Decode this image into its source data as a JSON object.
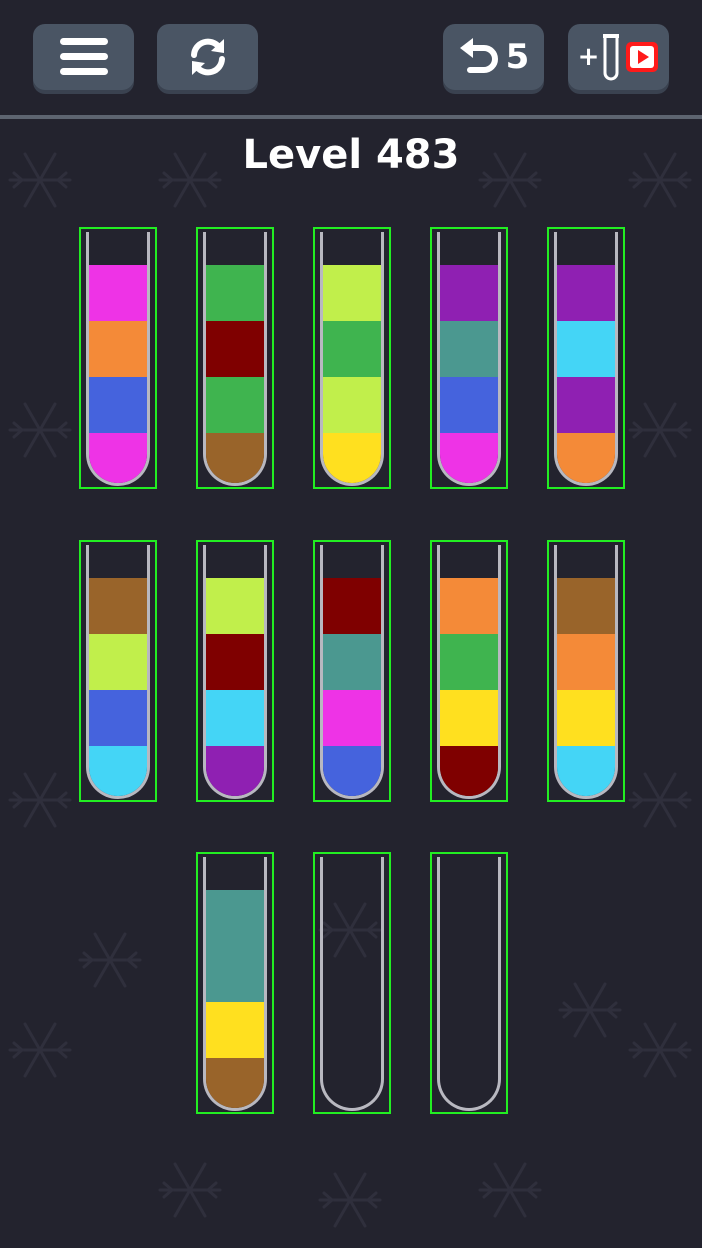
{
  "header": {
    "menu_icon": "hamburger-menu-icon",
    "restart_icon": "refresh-icon",
    "undo_icon": "undo-arrow-icon",
    "undo_count": "5",
    "add_tube_label": "+",
    "add_tube_icons": [
      "test-tube-icon",
      "video-ad-icon"
    ]
  },
  "level_title": "Level 483",
  "colors": {
    "magenta": "#ee33e6",
    "orange": "#f48a38",
    "blue": "#4563dd",
    "green": "#3fb44f",
    "maroon": "#7f0000",
    "brown": "#99642a",
    "lime": "#c1ef4b",
    "yellow": "#ffe01f",
    "purple": "#8f20b2",
    "teal": "#4b9890",
    "cyan": "#44d5f6"
  },
  "tubes": [
    [
      "magenta",
      "orange",
      "blue",
      "magenta"
    ],
    [
      "green",
      "maroon",
      "green",
      "brown"
    ],
    [
      "lime",
      "green",
      "lime",
      "yellow"
    ],
    [
      "purple",
      "teal",
      "blue",
      "magenta"
    ],
    [
      "purple",
      "cyan",
      "purple",
      "orange"
    ],
    [
      "brown",
      "lime",
      "blue",
      "cyan"
    ],
    [
      "lime",
      "maroon",
      "cyan",
      "purple"
    ],
    [
      "maroon",
      "teal",
      "magenta",
      "blue"
    ],
    [
      "orange",
      "green",
      "yellow",
      "maroon"
    ],
    [
      "brown",
      "orange",
      "yellow",
      "cyan"
    ],
    [
      "teal",
      "teal",
      "yellow",
      "brown"
    ],
    [],
    []
  ]
}
